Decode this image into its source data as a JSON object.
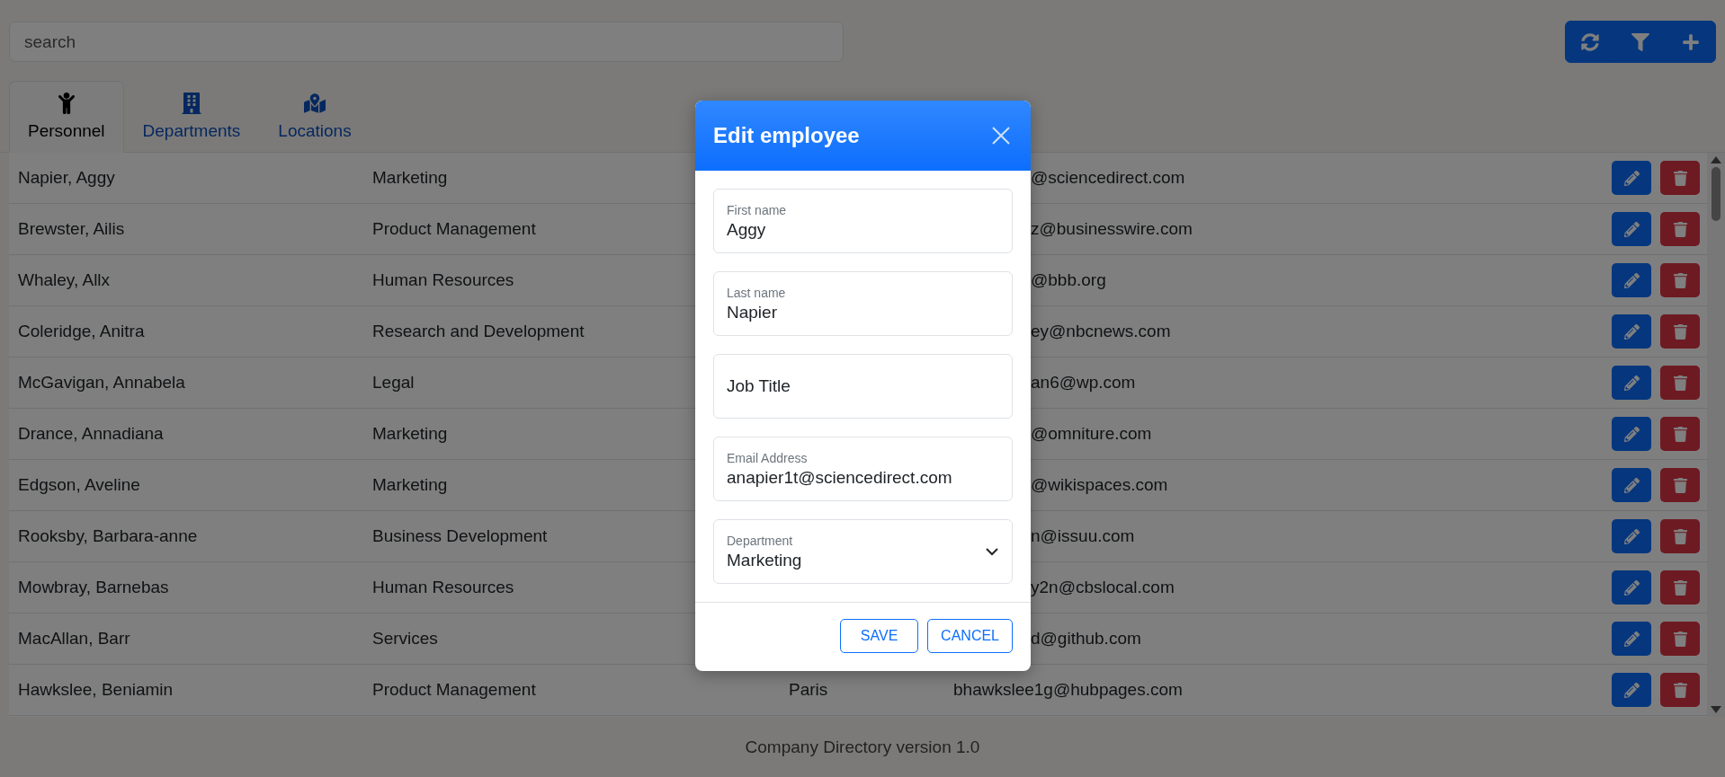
{
  "search": {
    "placeholder": "search"
  },
  "tabs": [
    {
      "kind": "person",
      "label": "Personnel",
      "selected": true
    },
    {
      "kind": "building",
      "label": "Departments",
      "selected": false
    },
    {
      "kind": "map",
      "label": "Locations",
      "selected": false
    }
  ],
  "rows": [
    {
      "name": "Napier, Aggy",
      "department": "Marketing",
      "email": "@sciencedirect.com"
    },
    {
      "name": "Brewster, Ailis",
      "department": "Product Management",
      "email": "z@businesswire.com"
    },
    {
      "name": "Whaley, Allx",
      "department": "Human Resources",
      "email": "@bbb.org"
    },
    {
      "name": "Coleridge, Anitra",
      "department": "Research and Development",
      "email": "ey@nbcnews.com"
    },
    {
      "name": "McGavigan, Annabela",
      "department": "Legal",
      "email": "an6@wp.com"
    },
    {
      "name": "Drance, Annadiana",
      "department": "Marketing",
      "email": "@omniture.com"
    },
    {
      "name": "Edgson, Aveline",
      "department": "Marketing",
      "email": "@wikispaces.com"
    },
    {
      "name": "Rooksby, Barbara-anne",
      "department": "Business Development",
      "email": "n@issuu.com"
    },
    {
      "name": "Mowbray, Barnebas",
      "department": "Human Resources",
      "email": "y2n@cbslocal.com"
    },
    {
      "name": "MacAllan, Barr",
      "department": "Services",
      "email": "d@github.com"
    },
    {
      "name": "Hawkslee, Beniamin",
      "department": "Product Management",
      "location": "Paris",
      "email": "bhawkslee1g@hubpages.com"
    }
  ],
  "dialog": {
    "title": "Edit employee",
    "fields": [
      {
        "kind": "text",
        "label": "First name",
        "value": "Aggy"
      },
      {
        "kind": "text",
        "label": "Last name",
        "value": "Napier"
      },
      {
        "kind": "text",
        "label": "Job Title"
      },
      {
        "kind": "text",
        "label": "Email Address",
        "value": "anapier1t@sciencedirect.com"
      },
      {
        "kind": "select",
        "label": "Department",
        "value": "Marketing"
      }
    ],
    "buttons": [
      "SAVE",
      "CANCEL"
    ]
  },
  "footer": "Company Directory version 1.0"
}
